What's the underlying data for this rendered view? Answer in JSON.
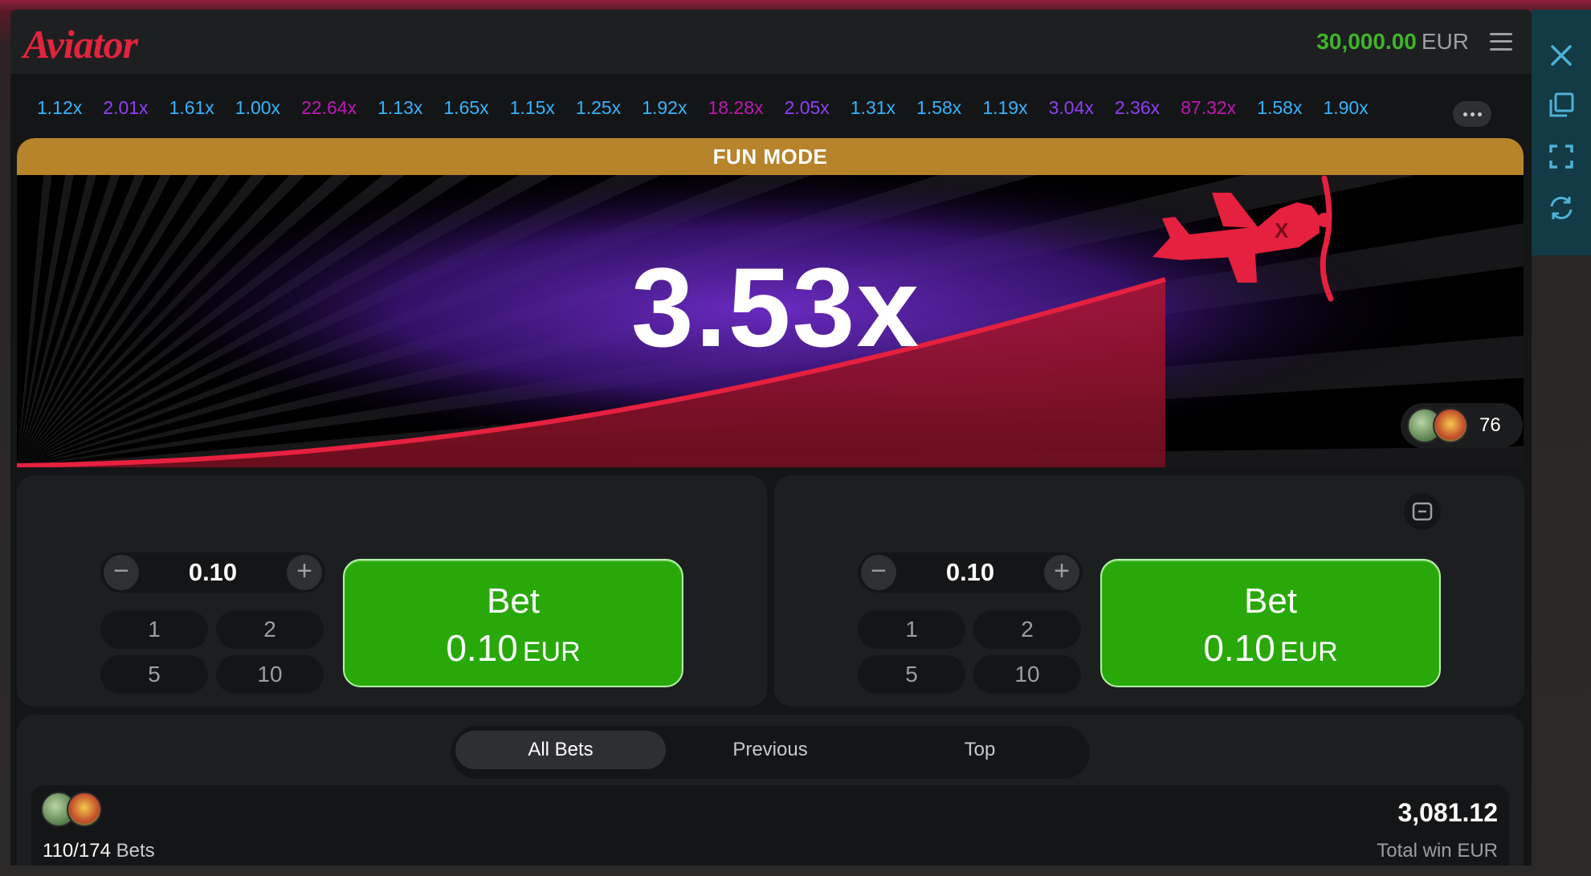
{
  "header": {
    "logo": "Aviator",
    "balance_amount": "30,000.00",
    "balance_currency": "EUR",
    "menu_icon": "hamburger-menu-icon"
  },
  "history": {
    "items": [
      {
        "value": "1.12x",
        "tier": "blue"
      },
      {
        "value": "2.01x",
        "tier": "purple"
      },
      {
        "value": "1.61x",
        "tier": "blue"
      },
      {
        "value": "1.00x",
        "tier": "blue"
      },
      {
        "value": "22.64x",
        "tier": "pink"
      },
      {
        "value": "1.13x",
        "tier": "blue"
      },
      {
        "value": "1.65x",
        "tier": "blue"
      },
      {
        "value": "1.15x",
        "tier": "blue"
      },
      {
        "value": "1.25x",
        "tier": "blue"
      },
      {
        "value": "1.92x",
        "tier": "blue"
      },
      {
        "value": "18.28x",
        "tier": "pink"
      },
      {
        "value": "2.05x",
        "tier": "purple"
      },
      {
        "value": "1.31x",
        "tier": "blue"
      },
      {
        "value": "1.58x",
        "tier": "blue"
      },
      {
        "value": "1.19x",
        "tier": "blue"
      },
      {
        "value": "3.04x",
        "tier": "purple"
      },
      {
        "value": "2.36x",
        "tier": "purple"
      },
      {
        "value": "87.32x",
        "tier": "pink"
      },
      {
        "value": "1.58x",
        "tier": "blue"
      },
      {
        "value": "1.90x",
        "tier": "blue"
      }
    ],
    "more_icon": "more-dots-icon"
  },
  "stage": {
    "banner": "FUN MODE",
    "multiplier": "3.53x",
    "players_count": "76"
  },
  "bet_panels": [
    {
      "amount": "0.10",
      "quick": [
        "1",
        "2",
        "5",
        "10"
      ],
      "bet_label": "Bet",
      "bet_amount": "0.10",
      "bet_currency": "EUR"
    },
    {
      "amount": "0.10",
      "quick": [
        "1",
        "2",
        "5",
        "10"
      ],
      "bet_label": "Bet",
      "bet_amount": "0.10",
      "bet_currency": "EUR"
    }
  ],
  "bets": {
    "tabs": [
      "All Bets",
      "Previous",
      "Top"
    ],
    "active_tab": "All Bets",
    "count": "110/174",
    "count_label": "Bets",
    "total_win": "3,081.12",
    "total_win_label": "Total win EUR",
    "progress_fraction": 0.3
  },
  "side_rail": {
    "icons": [
      "close-icon",
      "popout-window-icon",
      "fullscreen-icon",
      "refresh-icon"
    ]
  },
  "colors": {
    "brand_red": "#e2243d",
    "balance_green": "#3fb529",
    "bet_green": "#28a909",
    "multiplier_blue": "#34b4ff",
    "multiplier_purple": "#913ef8",
    "multiplier_pink": "#c017b4",
    "fun_mode_gold": "#b7832b",
    "rail_teal": "#123b46"
  }
}
